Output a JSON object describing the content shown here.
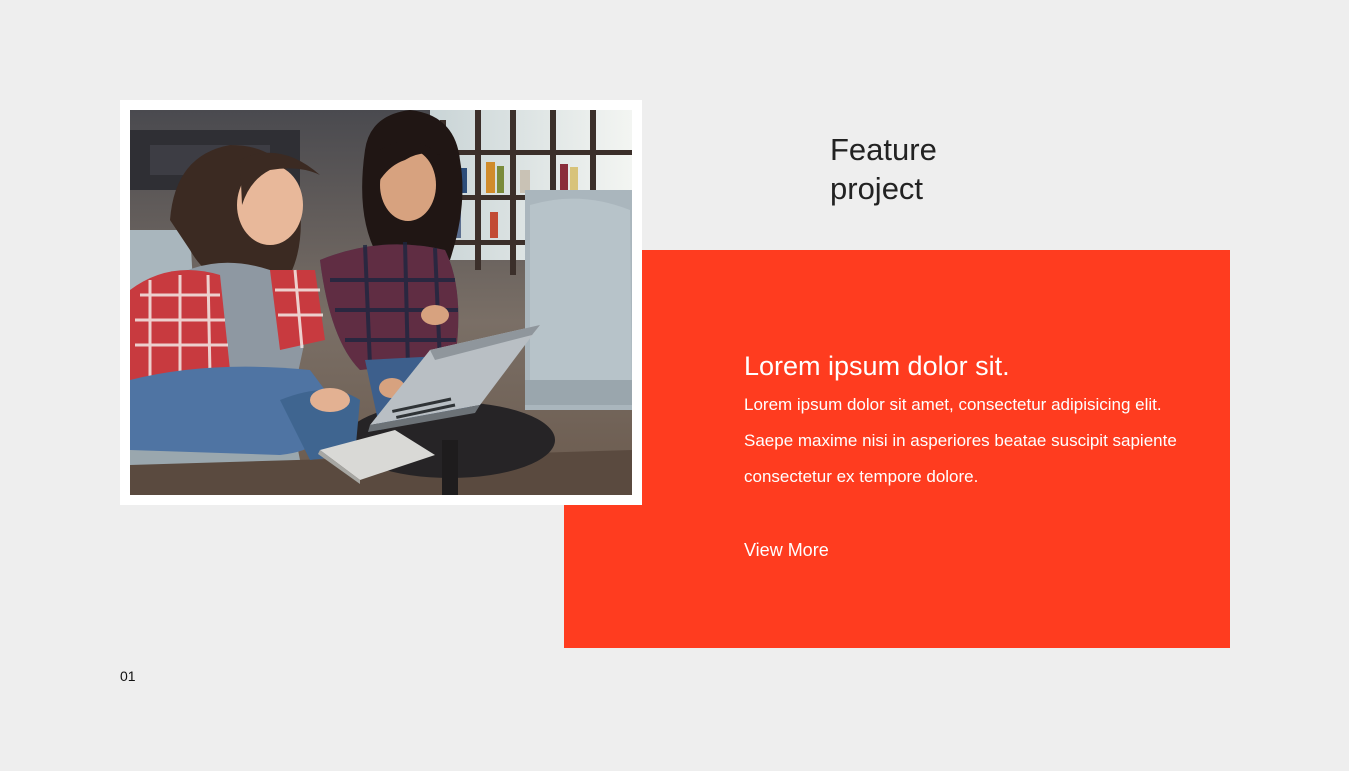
{
  "feature": {
    "title_line1": "Feature",
    "title_line2": "project"
  },
  "card": {
    "heading": "Lorem ipsum dolor sit.",
    "body": "Lorem ipsum dolor sit amet, consectetur adipisicing elit. Saepe maxime nisi in asperiores beatae suscipit sapiente consectetur ex tempore dolore.",
    "link_label": "View More"
  },
  "slide": {
    "number": "01"
  },
  "colors": {
    "background": "#eeeeee",
    "accent": "#ff3c1f",
    "frame": "#ffffff",
    "title_text": "#222222"
  }
}
